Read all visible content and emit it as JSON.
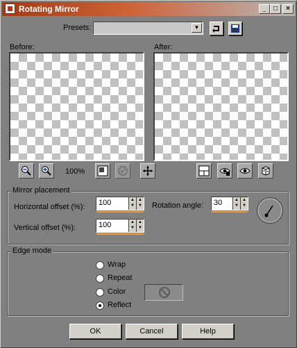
{
  "window": {
    "title": "Rotating Mirror",
    "controls": {
      "minimize": "_",
      "maximize": "□",
      "close": "×"
    }
  },
  "presets": {
    "label": "Presets:",
    "value": "",
    "icons": {
      "reset": "reset-presets-icon",
      "save": "save-preset-icon"
    }
  },
  "preview": {
    "before_label": "Before:",
    "after_label": "After:",
    "zoom": "100%",
    "tools_left": [
      "zoom-out-icon",
      "zoom-in-icon",
      "zoom-fit-icon",
      "proof-icon",
      "pan-icon"
    ],
    "tools_right": [
      "toggle-preview-icon",
      "auto-proof-icon",
      "eye-icon",
      "randomize-icon"
    ]
  },
  "mirror_placement": {
    "title": "Mirror placement",
    "horizontal_label": "Horizontal offset (%):",
    "horizontal_value": "100",
    "vertical_label": "Vertical offset (%):",
    "vertical_value": "100",
    "rotation_label": "Rotation angle:",
    "rotation_value": "30"
  },
  "edge_mode": {
    "title": "Edge mode",
    "options": [
      {
        "label": "Wrap",
        "checked": false
      },
      {
        "label": "Repeat",
        "checked": false
      },
      {
        "label": "Color",
        "checked": false
      },
      {
        "label": "Reflect",
        "checked": true
      }
    ]
  },
  "buttons": {
    "ok": "OK",
    "cancel": "Cancel",
    "help": "Help"
  }
}
